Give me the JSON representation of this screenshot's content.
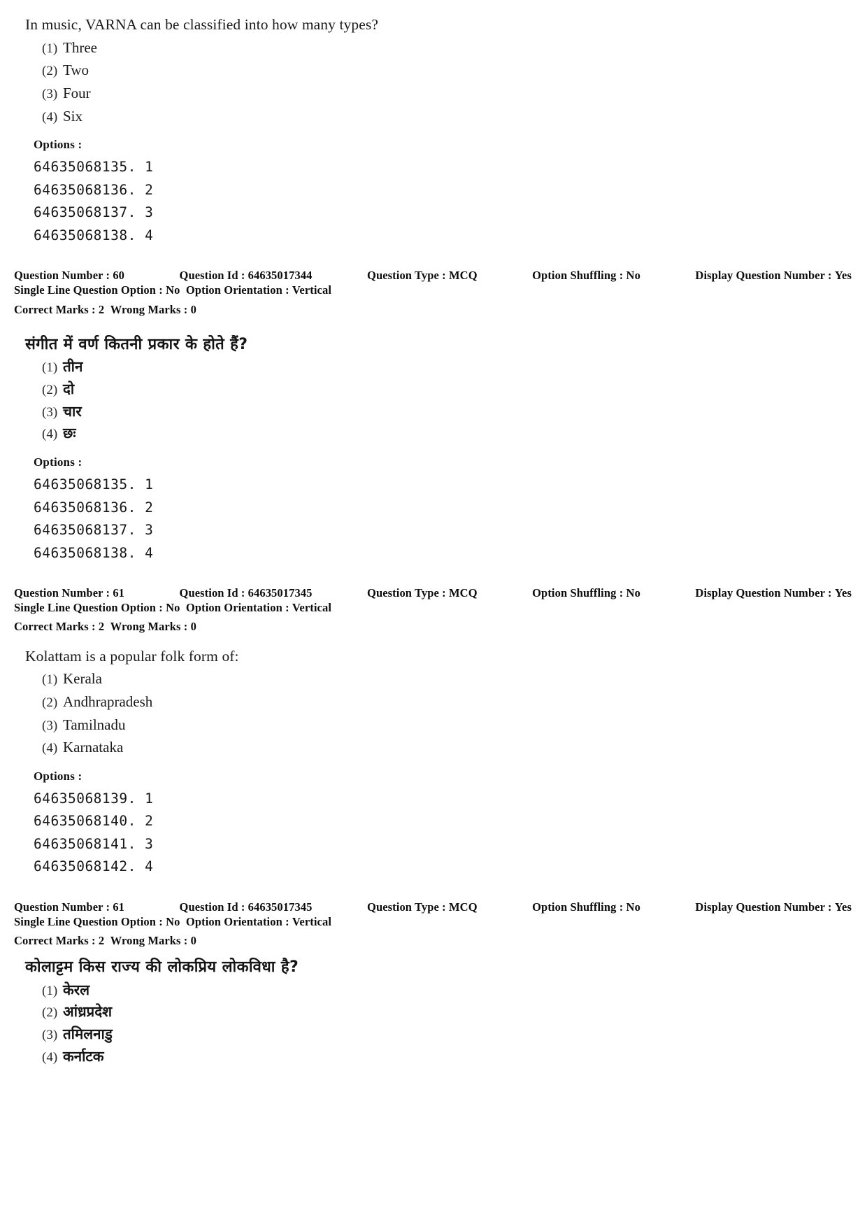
{
  "page": {
    "labels": {
      "options_heading": "Options :",
      "question_number": "Question Number :",
      "question_id": "Question Id :",
      "question_type": "Question Type :",
      "option_shuffling": "Option Shuffling :",
      "display_question_number": "Display Question Number :",
      "single_line_question_option": "Single Line Question Option :",
      "option_orientation": "Option Orientation :",
      "correct_marks": "Correct Marks :",
      "wrong_marks": "Wrong Marks :"
    }
  },
  "blocks": [
    {
      "id": "q60-english",
      "language": "english",
      "stem": "In music, VARNA can be classified into how many types?",
      "options": [
        {
          "num": "(1)",
          "text": "Three"
        },
        {
          "num": "(2)",
          "text": "Two"
        },
        {
          "num": "(3)",
          "text": "Four"
        },
        {
          "num": "(4)",
          "text": "Six"
        }
      ],
      "options_heading": "Options :",
      "option_ids": [
        {
          "id": "64635068135.",
          "index": "1"
        },
        {
          "id": "64635068136.",
          "index": "2"
        },
        {
          "id": "64635068137.",
          "index": "3"
        },
        {
          "id": "64635068138.",
          "index": "4"
        }
      ]
    },
    {
      "id": "q60-hindi",
      "language": "hindi",
      "stem": "संगीत में वर्ण कितनी प्रकार के होते हैं?",
      "options": [
        {
          "num": "(1)",
          "text": "तीन"
        },
        {
          "num": "(2)",
          "text": "दो"
        },
        {
          "num": "(3)",
          "text": "चार"
        },
        {
          "num": "(4)",
          "text": "छः"
        }
      ],
      "options_heading": "Options :",
      "option_ids": [
        {
          "id": "64635068135.",
          "index": "1"
        },
        {
          "id": "64635068136.",
          "index": "2"
        },
        {
          "id": "64635068137.",
          "index": "3"
        },
        {
          "id": "64635068138.",
          "index": "4"
        }
      ]
    },
    {
      "id": "q61-english",
      "language": "english",
      "stem": "Kolattam is a popular folk form of:",
      "options": [
        {
          "num": "(1)",
          "text": "Kerala"
        },
        {
          "num": "(2)",
          "text": "Andhrapradesh"
        },
        {
          "num": "(3)",
          "text": "Tamilnadu"
        },
        {
          "num": "(4)",
          "text": "Karnataka"
        }
      ],
      "options_heading": "Options :",
      "option_ids": [
        {
          "id": "64635068139.",
          "index": "1"
        },
        {
          "id": "64635068140.",
          "index": "2"
        },
        {
          "id": "64635068141.",
          "index": "3"
        },
        {
          "id": "64635068142.",
          "index": "4"
        }
      ]
    },
    {
      "id": "q61-hindi",
      "language": "hindi",
      "stem": "कोलाट्टम किस राज्य की लोकप्रिय लोकविधा है?",
      "options": [
        {
          "num": "(1)",
          "text": "केरल"
        },
        {
          "num": "(2)",
          "text": "आंध्रप्रदेश"
        },
        {
          "num": "(3)",
          "text": "तमिलनाडु"
        },
        {
          "num": "(4)",
          "text": "कर्नाटक"
        }
      ]
    }
  ],
  "meta": [
    {
      "id": "meta-q60",
      "question_number": "60",
      "question_id": "64635017344",
      "question_type": "MCQ",
      "option_shuffling": "No",
      "display_question_number": "Yes",
      "single_line_question_option": "No",
      "option_orientation": "Vertical",
      "correct_marks": "2",
      "wrong_marks": "0"
    },
    {
      "id": "meta-q61-a",
      "question_number": "61",
      "question_id": "64635017345",
      "question_type": "MCQ",
      "option_shuffling": "No",
      "display_question_number": "Yes",
      "single_line_question_option": "No",
      "option_orientation": "Vertical",
      "correct_marks": "2",
      "wrong_marks": "0"
    },
    {
      "id": "meta-q61-b",
      "question_number": "61",
      "question_id": "64635017345",
      "question_type": "MCQ",
      "option_shuffling": "No",
      "display_question_number": "Yes",
      "single_line_question_option": "No",
      "option_orientation": "Vertical",
      "correct_marks": "2",
      "wrong_marks": "0"
    }
  ]
}
